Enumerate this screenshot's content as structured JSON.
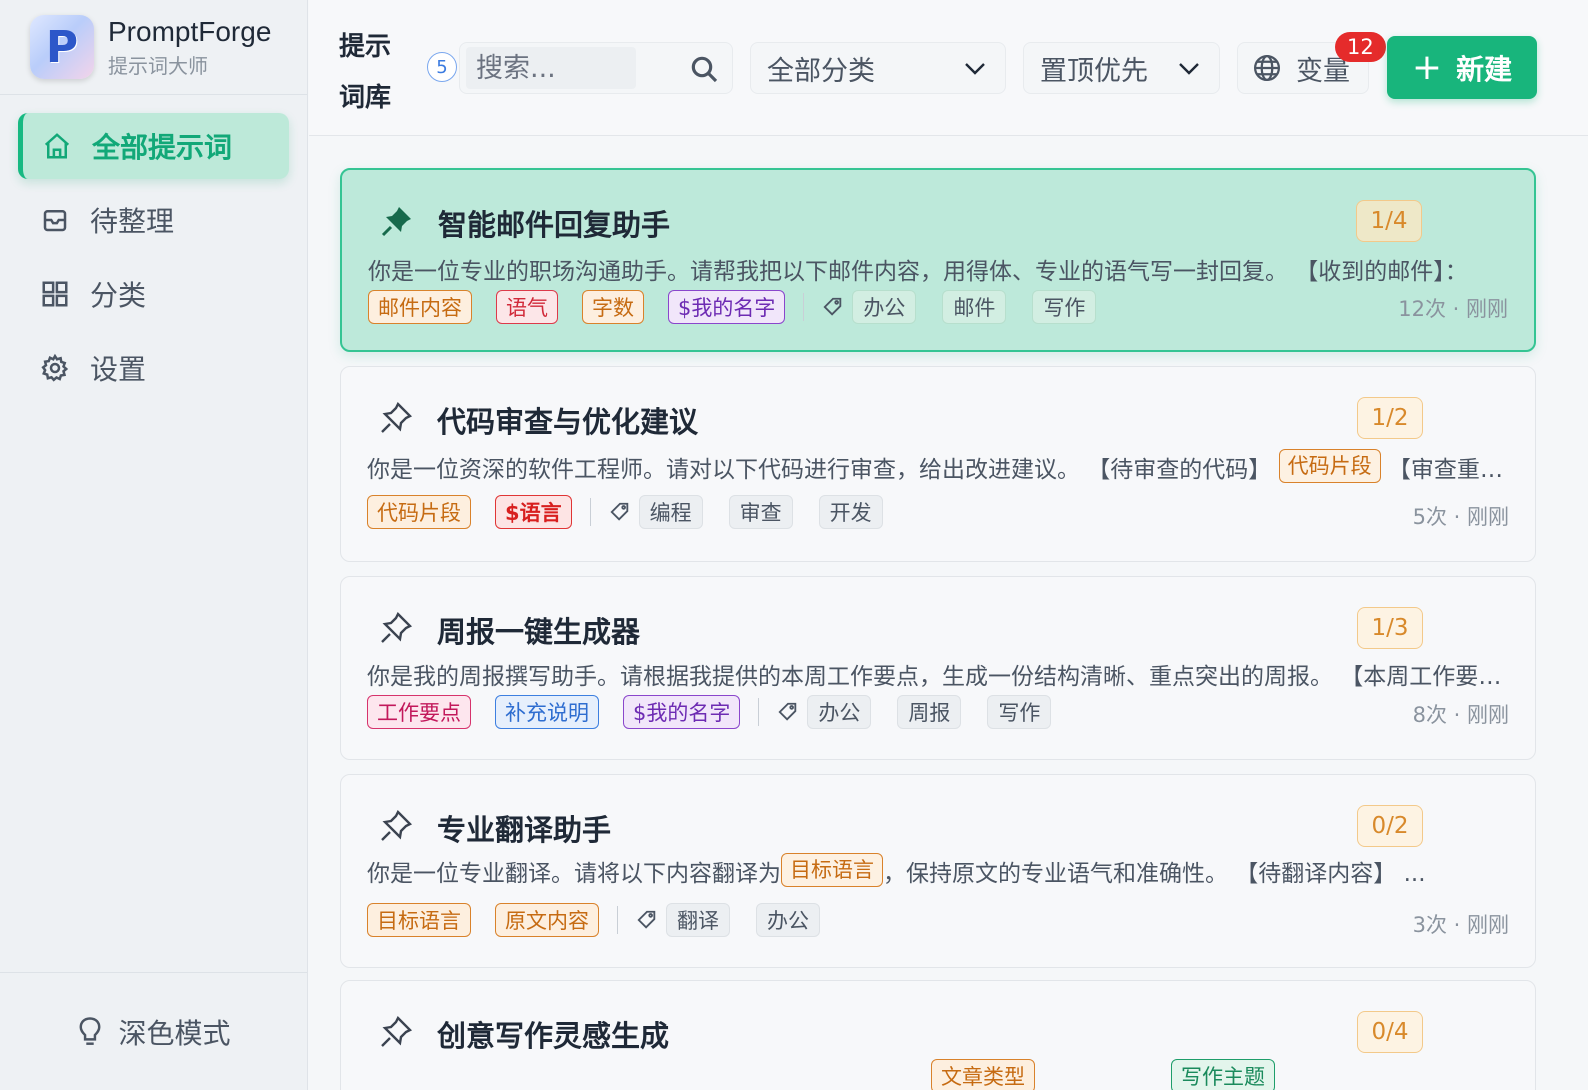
{
  "brand": {
    "name": "PromptForge",
    "subtitle": "提示词大师",
    "logo_letter": "P"
  },
  "sidebar": {
    "items": [
      {
        "label": "全部提示词",
        "icon": "home-icon",
        "active": true
      },
      {
        "label": "待整理",
        "icon": "inbox-icon",
        "active": false
      },
      {
        "label": "分类",
        "icon": "grid-icon",
        "active": false
      },
      {
        "label": "设置",
        "icon": "gear-icon",
        "active": false
      }
    ],
    "dark_mode_label": "深色模式"
  },
  "header": {
    "title": "提示词库",
    "count": "5",
    "search_placeholder": "搜索...",
    "category_select": "全部分类",
    "sort_select": "置顶优先",
    "variables_label": "变量",
    "variables_badge": "12",
    "new_button": "新建",
    "accent_color": "#18b57c"
  },
  "prompts": [
    {
      "title": "智能邮件回复助手",
      "pinned": true,
      "progress": "1/4",
      "desc_before": "你是一位专业的职场沟通助手。请帮我把以下邮件内容，用得体、专业的语气写一封回复。 【收到的邮件】：",
      "desc_tag": "",
      "desc_after": "",
      "variables": [
        {
          "label": "邮件内容",
          "color": "orange"
        },
        {
          "label": "语气",
          "color": "red"
        },
        {
          "label": "字数",
          "color": "orange"
        },
        {
          "label": "$我的名字",
          "color": "purple"
        }
      ],
      "tags": [
        "办公",
        "邮件",
        "写作"
      ],
      "meta": "12次 · 刚刚"
    },
    {
      "title": "代码审查与优化建议",
      "pinned": false,
      "progress": "1/2",
      "desc_before": "你是一位资深的软件工程师。请对以下代码进行审查，给出改进建议。 【待审查的代码】",
      "desc_tag": "代码片段",
      "desc_after": " 【审查重点】",
      "variables": [
        {
          "label": "代码片段",
          "color": "orange"
        },
        {
          "label": "$语言",
          "color": "crimson"
        }
      ],
      "tags": [
        "编程",
        "审查",
        "开发"
      ],
      "meta": "5次 · 刚刚"
    },
    {
      "title": "周报一键生成器",
      "pinned": false,
      "progress": "1/3",
      "desc_before": "你是我的周报撰写助手。请根据我提供的本周工作要点，生成一份结构清晰、重点突出的周报。 【本周工作要点】",
      "desc_tag": "",
      "desc_after": "",
      "variables": [
        {
          "label": "工作要点",
          "color": "pink"
        },
        {
          "label": "补充说明",
          "color": "blue"
        },
        {
          "label": "$我的名字",
          "color": "purple"
        }
      ],
      "tags": [
        "办公",
        "周报",
        "写作"
      ],
      "meta": "8次 · 刚刚"
    },
    {
      "title": "专业翻译助手",
      "pinned": false,
      "progress": "0/2",
      "desc_before": "你是一位专业翻译。请将以下内容翻译为",
      "desc_tag": "目标语言",
      "desc_after": "，保持原文的专业语气和准确性。 【待翻译内容】 ...",
      "variables": [
        {
          "label": "目标语言",
          "color": "orange"
        },
        {
          "label": "原文内容",
          "color": "orange"
        }
      ],
      "tags": [
        "翻译",
        "办公"
      ],
      "meta": "3次 · 刚刚"
    },
    {
      "title": "创意写作灵感生成",
      "pinned": false,
      "progress": "0/4",
      "desc_before": "",
      "desc_tag": "",
      "desc_after": "",
      "peek_tags": [
        {
          "label": "文章类型",
          "color": "orange"
        },
        {
          "label": "写作主题",
          "color": "green"
        }
      ],
      "variables": [],
      "tags": [],
      "meta": ""
    }
  ]
}
